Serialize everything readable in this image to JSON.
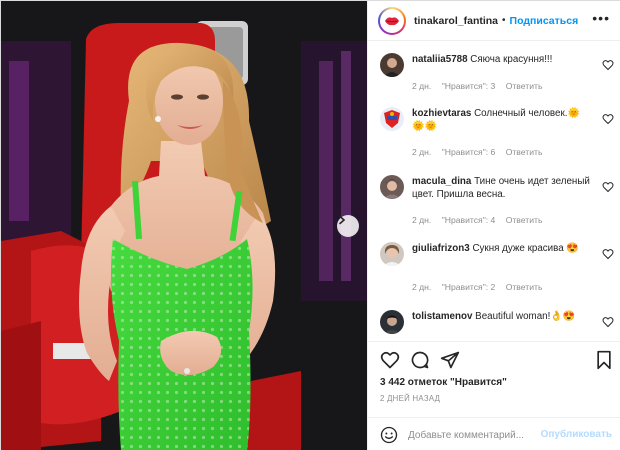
{
  "header": {
    "username": "tinakarol_fantina",
    "separator": "•",
    "follow_label": "Подписаться",
    "more_icon": "more-horizontal-icon"
  },
  "comments": [
    {
      "username": "nataliia5788",
      "text": "Сяюча красуння!!!",
      "age": "2 дн.",
      "likes": "\"Нравится\": 3",
      "reply": "Ответить",
      "emoji": ""
    },
    {
      "username": "kozhievtaras",
      "text": "Солнечный человек.",
      "age": "2 дн.",
      "likes": "\"Нравится\": 6",
      "reply": "Ответить",
      "emoji": "🌞🌞🌞"
    },
    {
      "username": "macula_dina",
      "text": "Тине очень идет зеленый цвет. Пришла весна.",
      "age": "2 дн.",
      "likes": "\"Нравится\": 4",
      "reply": "Ответить",
      "emoji": ""
    },
    {
      "username": "giuliafrizon3",
      "text": "Сукня дуже красива",
      "age": "2 дн.",
      "likes": "\"Нравится\": 2",
      "reply": "Ответить",
      "emoji": "😍"
    },
    {
      "username": "tolistamenov",
      "text": "Beautiful woman!",
      "age": "",
      "likes": "",
      "reply": "",
      "emoji": "👌😍"
    }
  ],
  "stats": {
    "likes_text": "3 442 отметок \"Нравится\"",
    "posted": "2 ДНЕЙ НАЗАД"
  },
  "composer": {
    "placeholder": "Добавьте комментарий...",
    "publish_label": "Опубликовать"
  },
  "colors": {
    "accent": "#0095f6",
    "publish_disabled": "#b3dbff",
    "muted": "#8e8e8e",
    "dress": "#3fd33a",
    "chair": "#c8191b"
  }
}
